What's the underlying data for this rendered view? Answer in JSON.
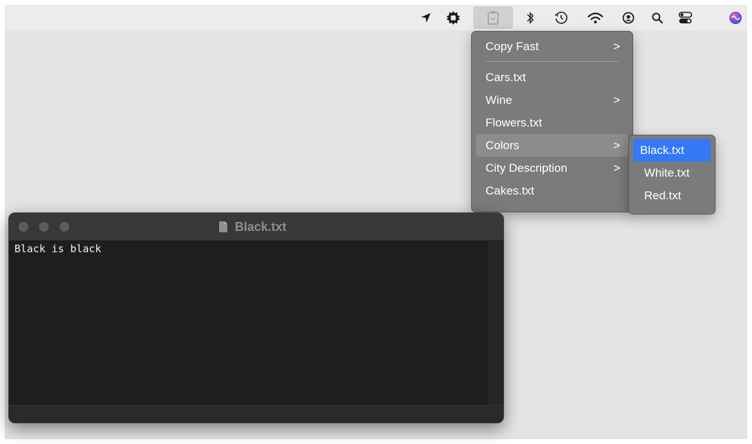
{
  "menubar": {
    "icons": [
      {
        "name": "location-arrow-icon"
      },
      {
        "name": "gear-badge-icon"
      },
      {
        "name": "clipboard-icon"
      },
      {
        "name": "bluetooth-icon"
      },
      {
        "name": "time-machine-icon"
      },
      {
        "name": "wifi-icon"
      },
      {
        "name": "user-account-icon"
      },
      {
        "name": "spotlight-search-icon"
      },
      {
        "name": "control-center-icon"
      },
      {
        "name": "siri-icon"
      }
    ]
  },
  "menu": {
    "items": [
      {
        "label": "Copy Fast",
        "arrow": ">"
      },
      {
        "label": "Cars.txt",
        "arrow": ""
      },
      {
        "label": "Wine",
        "arrow": ">"
      },
      {
        "label": "Flowers.txt",
        "arrow": ""
      },
      {
        "label": "Colors",
        "arrow": ">"
      },
      {
        "label": "City Description",
        "arrow": ">"
      },
      {
        "label": "Cakes.txt",
        "arrow": ""
      }
    ]
  },
  "submenu": {
    "items": [
      {
        "label": "Black.txt"
      },
      {
        "label": "White.txt"
      },
      {
        "label": "Red.txt"
      }
    ]
  },
  "window": {
    "title": "Black.txt",
    "content": "Black is black"
  },
  "colors": {
    "selection": "#3478f6",
    "menu_bg": "#7b7b7b",
    "window_bg": "#1e1e1e"
  }
}
